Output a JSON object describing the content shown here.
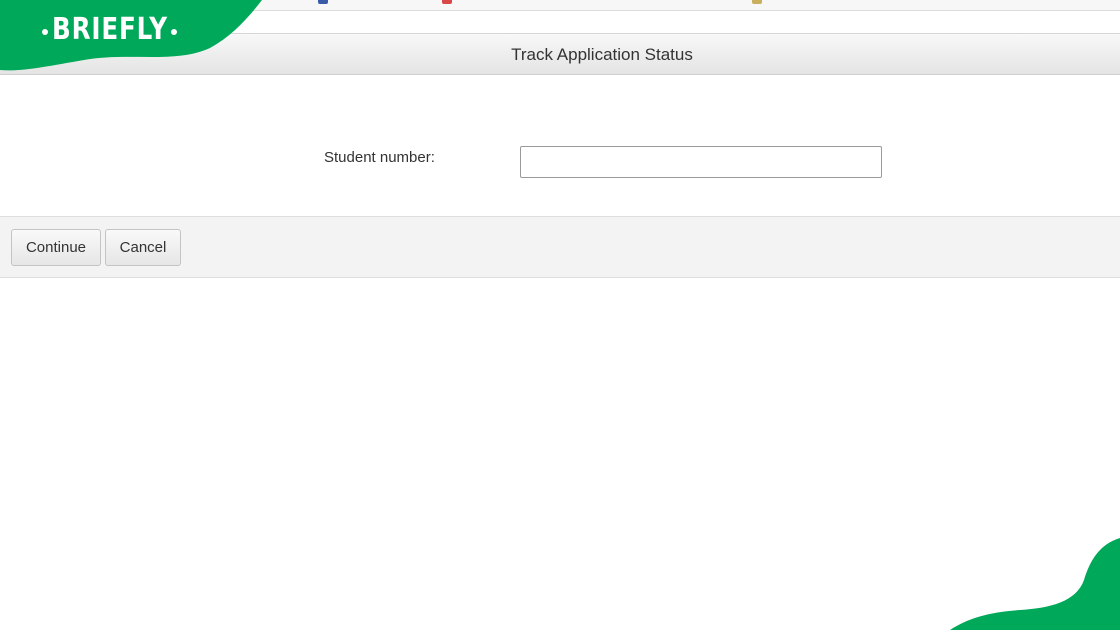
{
  "brand": {
    "logo_text": "BRIEFLY",
    "color": "#00a85a"
  },
  "page": {
    "title": "Track Application Status"
  },
  "form": {
    "student_number_label": "Student number:",
    "student_number_value": ""
  },
  "actions": {
    "continue_label": "Continue",
    "cancel_label": "Cancel"
  }
}
